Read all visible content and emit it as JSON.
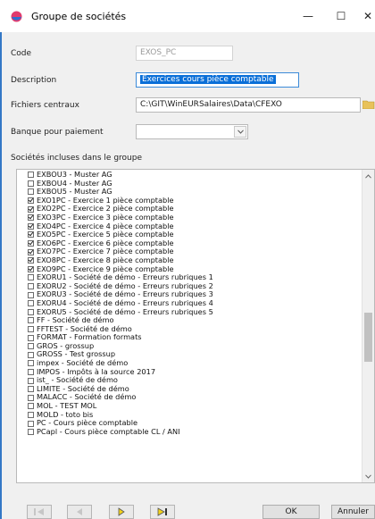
{
  "window": {
    "title": "Groupe de sociétés",
    "minimize": "—",
    "maximize": "☐",
    "close": "✕"
  },
  "form": {
    "code_label": "Code",
    "code_value": "EXOS_PC",
    "description_label": "Description",
    "description_value": "Exercices cours pièce comptable",
    "central_files_label": "Fichiers centraux",
    "central_files_value": "C:\\GIT\\WinEURSalaires\\Data\\CFEXO",
    "bank_label": "Banque pour paiement",
    "bank_value": "",
    "group_label": "Sociétés incluses dans le groupe"
  },
  "companies": [
    {
      "label": "EXBOU3 - Muster AG",
      "checked": false
    },
    {
      "label": "EXBOU4 - Muster AG",
      "checked": false
    },
    {
      "label": "EXBOU5 - Muster AG",
      "checked": false
    },
    {
      "label": "EXO1PC - Exercice 1 pièce comptable",
      "checked": true
    },
    {
      "label": "EXO2PC - Exercice 2 pièce comptable",
      "checked": true
    },
    {
      "label": "EXO3PC - Exercice 3 pièce comptable",
      "checked": true
    },
    {
      "label": "EXO4PC - Exercice 4 pièce comptable",
      "checked": true
    },
    {
      "label": "EXO5PC - Exercice 5 pièce comptable",
      "checked": true
    },
    {
      "label": "EXO6PC - Exercice 6 pièce comptable",
      "checked": true
    },
    {
      "label": "EXO7PC - Exercice 7 pièce comptable",
      "checked": true
    },
    {
      "label": "EXO8PC - Exercice 8 pièce comptable",
      "checked": true
    },
    {
      "label": "EXO9PC - Exercice 9 pièce comptable",
      "checked": true
    },
    {
      "label": "EXORU1 - Société de démo - Erreurs rubriques 1",
      "checked": false
    },
    {
      "label": "EXORU2 - Société de démo - Erreurs rubriques 2",
      "checked": false
    },
    {
      "label": "EXORU3 - Société de démo - Erreurs rubriques 3",
      "checked": false
    },
    {
      "label": "EXORU4 - Société de démo - Erreurs rubriques 4",
      "checked": false
    },
    {
      "label": "EXORU5 - Société de démo - Erreurs rubriques 5",
      "checked": false
    },
    {
      "label": "FF - Société de démo",
      "checked": false
    },
    {
      "label": "FFTEST - Société de démo",
      "checked": false
    },
    {
      "label": "FORMAT - Formation formats",
      "checked": false
    },
    {
      "label": "GROS - grossup",
      "checked": false
    },
    {
      "label": "GROSS - Test grossup",
      "checked": false
    },
    {
      "label": "impex - Société de démo",
      "checked": false
    },
    {
      "label": "IMPOS - Impôts à la source 2017",
      "checked": false
    },
    {
      "label": "ist_ - Société de démo",
      "checked": false
    },
    {
      "label": "LIMITE - Société de démo",
      "checked": false
    },
    {
      "label": "MALACC - Société de démo",
      "checked": false
    },
    {
      "label": "MOL - TEST MOL",
      "checked": false
    },
    {
      "label": "MOLD - toto bis",
      "checked": false
    },
    {
      "label": "PC - Cours pièce comptable",
      "checked": false
    },
    {
      "label": "PCapl - Cours pièce comptable CL / ANI",
      "checked": false
    }
  ],
  "buttons": {
    "ok": "OK",
    "cancel": "Annuler"
  },
  "colors": {
    "accent": "#0a6fd8",
    "nav_arrow": "#f2d11b",
    "window_edge": "#3478c6"
  }
}
